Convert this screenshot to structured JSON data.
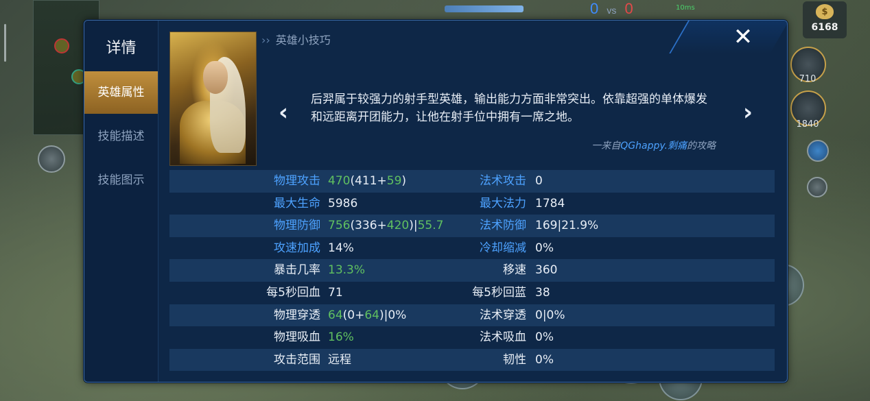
{
  "background": {
    "gold": "6168",
    "items": [
      {
        "icon": "boots-icon",
        "cost": "710"
      },
      {
        "icon": "bow-icon",
        "cost": "1840"
      }
    ],
    "score_left": "0",
    "score_vs": "vs",
    "score_right": "0",
    "ping": "10ms"
  },
  "panel": {
    "title": "详情",
    "tabs": [
      "英雄属性",
      "技能描述",
      "技能图示"
    ],
    "active_tab": 0,
    "tips_header": "英雄小技巧",
    "tip_text": "后羿属于较强力的射手型英雄，输出能力方面非常突出。依靠超强的单体爆发和远距离开团能力，让他在射手位中拥有一席之地。",
    "tip_source_prefix": "一来自",
    "tip_source_author": "QGhappy.剩痛",
    "tip_source_suffix": "的攻略",
    "close_icon": "✕"
  },
  "stats": [
    {
      "left_label": "物理攻击",
      "left_label_blue": true,
      "left_value": [
        {
          "t": "470",
          "g": true
        },
        {
          "t": "(411+"
        },
        {
          "t": "59",
          "g": true
        },
        {
          "t": ")"
        }
      ],
      "right_label": "法术攻击",
      "right_label_blue": true,
      "right_value": [
        {
          "t": "0"
        }
      ]
    },
    {
      "left_label": "最大生命",
      "left_label_blue": true,
      "left_value": [
        {
          "t": "5986"
        }
      ],
      "right_label": "最大法力",
      "right_label_blue": true,
      "right_value": [
        {
          "t": "1784"
        }
      ]
    },
    {
      "left_label": "物理防御",
      "left_label_blue": true,
      "left_value": [
        {
          "t": "756",
          "g": true
        },
        {
          "t": "(336+"
        },
        {
          "t": "420",
          "g": true
        },
        {
          "t": ")|"
        },
        {
          "t": "55.7",
          "g": true
        }
      ],
      "right_label": "法术防御",
      "right_label_blue": true,
      "right_value": [
        {
          "t": "169|21.9%"
        }
      ]
    },
    {
      "left_label": "攻速加成",
      "left_label_blue": true,
      "left_value": [
        {
          "t": "14%"
        }
      ],
      "right_label": "冷却缩减",
      "right_label_blue": true,
      "right_value": [
        {
          "t": "0%"
        }
      ]
    },
    {
      "left_label": "暴击几率",
      "left_label_blue": false,
      "left_value": [
        {
          "t": "13.3%",
          "g": true
        }
      ],
      "right_label": "移速",
      "right_label_blue": false,
      "right_value": [
        {
          "t": "360"
        }
      ]
    },
    {
      "left_label": "每5秒回血",
      "left_label_blue": false,
      "left_value": [
        {
          "t": "71"
        }
      ],
      "right_label": "每5秒回蓝",
      "right_label_blue": false,
      "right_value": [
        {
          "t": "38"
        }
      ]
    },
    {
      "left_label": "物理穿透",
      "left_label_blue": false,
      "left_value": [
        {
          "t": "64",
          "g": true
        },
        {
          "t": "(0+"
        },
        {
          "t": "64",
          "g": true
        },
        {
          "t": ")|0%"
        }
      ],
      "right_label": "法术穿透",
      "right_label_blue": false,
      "right_value": [
        {
          "t": "0|0%"
        }
      ]
    },
    {
      "left_label": "物理吸血",
      "left_label_blue": false,
      "left_value": [
        {
          "t": "16%",
          "g": true
        }
      ],
      "right_label": "法术吸血",
      "right_label_blue": false,
      "right_value": [
        {
          "t": "0%"
        }
      ]
    },
    {
      "left_label": "攻击范围",
      "left_label_blue": false,
      "left_value": [
        {
          "t": "远程"
        }
      ],
      "right_label": "韧性",
      "right_label_blue": false,
      "right_value": [
        {
          "t": "0%"
        }
      ]
    }
  ]
}
